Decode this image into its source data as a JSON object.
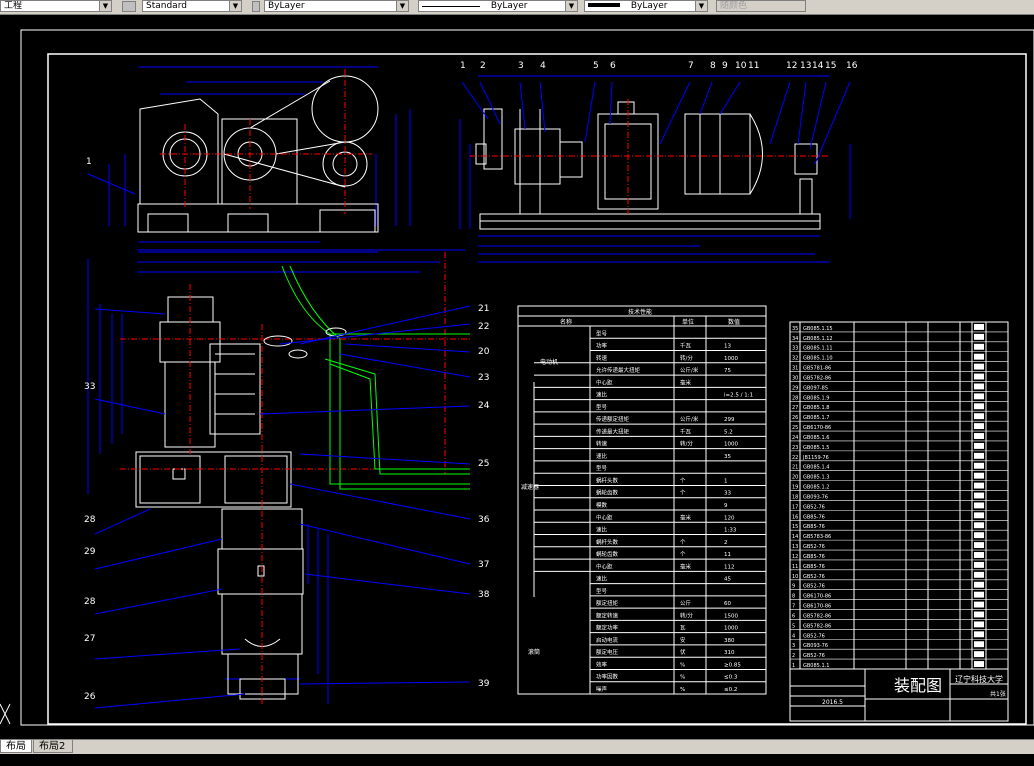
{
  "toolbar": {
    "workspace": "工程",
    "text_style": "Standard",
    "layer": "ByLayer",
    "linetype": "ByLayer",
    "lineweight": "ByLayer",
    "plot_style": "随颜色"
  },
  "drawing": {
    "part_labels_top": [
      "1",
      "2",
      "3",
      "4",
      "5",
      "6",
      "7",
      "8",
      "9",
      "10",
      "11",
      "12",
      "13",
      "14",
      "15",
      "16"
    ],
    "left_labels": [
      "1",
      "33",
      "28",
      "29",
      "28",
      "27",
      "26"
    ],
    "right_labels": [
      "21",
      "22",
      "20",
      "23",
      "24",
      "25",
      "36",
      "37",
      "38",
      "39"
    ],
    "tech_title": "技术性能",
    "tech_header": [
      "名称",
      "单位",
      "数值"
    ],
    "tech_groups": [
      "电动机",
      "减速器",
      "滚筒"
    ],
    "tech_rows": [
      [
        "型号",
        "",
        ""
      ],
      [
        "功率",
        "千瓦",
        "13"
      ],
      [
        "转速",
        "转/分",
        "1000"
      ],
      [
        "允许传递最大扭矩",
        "公斤/米",
        "75"
      ],
      [
        "中心距",
        "毫米",
        ""
      ],
      [
        "速比",
        "",
        "i=2.5 / 1:1"
      ],
      [
        "型号",
        "",
        ""
      ],
      [
        "传递额定扭矩",
        "公斤/米",
        "299"
      ],
      [
        "传递最大扭矩",
        "千瓦",
        "5.2"
      ],
      [
        "转速",
        "转/分",
        "1000"
      ],
      [
        "速比",
        "",
        "35"
      ],
      [
        "型号",
        "",
        ""
      ],
      [
        "蜗杆头数",
        "个",
        "1"
      ],
      [
        "蜗轮齿数",
        "个",
        "33"
      ],
      [
        "模数",
        "",
        "9"
      ],
      [
        "中心距",
        "毫米",
        "120"
      ],
      [
        "速比",
        "",
        "1:33"
      ],
      [
        "蜗杆头数",
        "个",
        "2"
      ],
      [
        "蜗轮齿数",
        "个",
        "11"
      ],
      [
        "中心距",
        "毫米",
        "112"
      ],
      [
        "速比",
        "",
        "45"
      ],
      [
        "型号",
        "",
        ""
      ],
      [
        "额定扭矩",
        "公斤",
        "60"
      ],
      [
        "额定转速",
        "转/分",
        "1500"
      ],
      [
        "额定功率",
        "瓦",
        "1000"
      ],
      [
        "启动电流",
        "安",
        "380"
      ],
      [
        "额定电压",
        "伏",
        "310"
      ],
      [
        "效率",
        "%",
        "≥0.85"
      ],
      [
        "功率因数",
        "%",
        "≤0.3"
      ],
      [
        "噪声",
        "%",
        "≤0.2"
      ]
    ],
    "bom_rows": [
      "GB085.1.15",
      "GB085.1.12",
      "GB085.1.11",
      "GB085.1.10",
      "GB5781-86",
      "GB5782-86",
      "GB097-85",
      "GB085.1.9",
      "GB085.1.8",
      "GB085.1.7",
      "GB6170-86",
      "GB085.1.6",
      "GB085.1.5",
      "JB1159-76",
      "GB085.1.4",
      "GB085.1.3",
      "GB085.1.2",
      "GB093-76",
      "GB52-76",
      "GB85-76",
      "GB85-76",
      "GB5783-86",
      "GB52-76",
      "GB85-76",
      "GB85-76",
      "GB52-76",
      "GB52-76",
      "GB6170-86",
      "GB6170-86",
      "GB5782-86",
      "GB5782-86",
      "GB52-76",
      "GB093-76",
      "GB52-76",
      "GB085.1.1"
    ],
    "title_block": {
      "title": "装配图",
      "school": "辽宁科技大学",
      "date": "2016.5",
      "sheet": "共1张"
    }
  },
  "tabs": [
    "布局1",
    "布局2"
  ],
  "colors": {
    "background": "#000000",
    "frame": "#ffffff",
    "dimension": "#0000ff",
    "centerline": "#ff0000",
    "hidden": "#00ff00",
    "leader": "#0000ff"
  }
}
